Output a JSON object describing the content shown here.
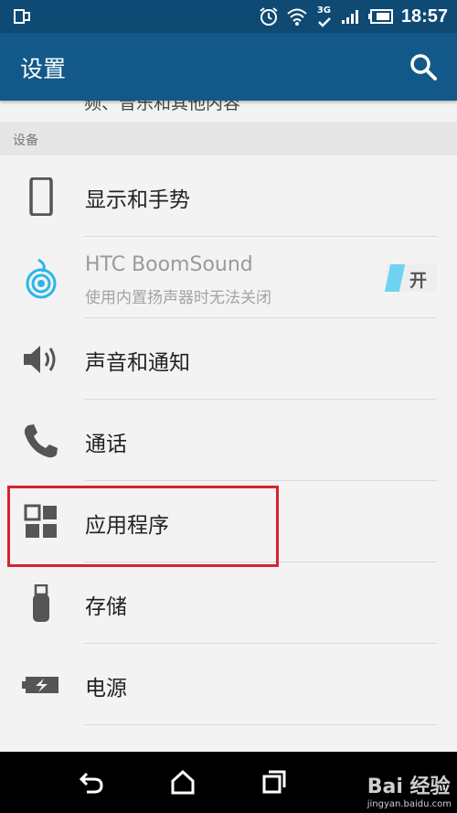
{
  "status_bar": {
    "time": "18:57",
    "network": "3G"
  },
  "app_bar": {
    "title": "设置"
  },
  "partial_item_text": "频、音乐和其他内容",
  "section_header": "设备",
  "items": [
    {
      "label": "显示和手势",
      "icon": "phone-display-icon"
    },
    {
      "label": "HTC BoomSound",
      "sublabel": "使用内置扬声器时无法关闭",
      "icon": "boomsound-icon",
      "toggle": "开",
      "disabled": true
    },
    {
      "label": "声音和通知",
      "icon": "speaker-icon"
    },
    {
      "label": "通话",
      "icon": "phone-icon"
    },
    {
      "label": "应用程序",
      "icon": "apps-grid-icon",
      "highlighted": true
    },
    {
      "label": "存储",
      "icon": "usb-storage-icon"
    },
    {
      "label": "电源",
      "icon": "battery-icon"
    }
  ],
  "watermark": {
    "text": "Bai 经验",
    "url": "jingyan.baidu.com"
  },
  "colors": {
    "status_bar": "#0e4a73",
    "app_bar": "#125989",
    "highlight": "#d5232e",
    "toggle_accent": "#6ed3f2"
  }
}
